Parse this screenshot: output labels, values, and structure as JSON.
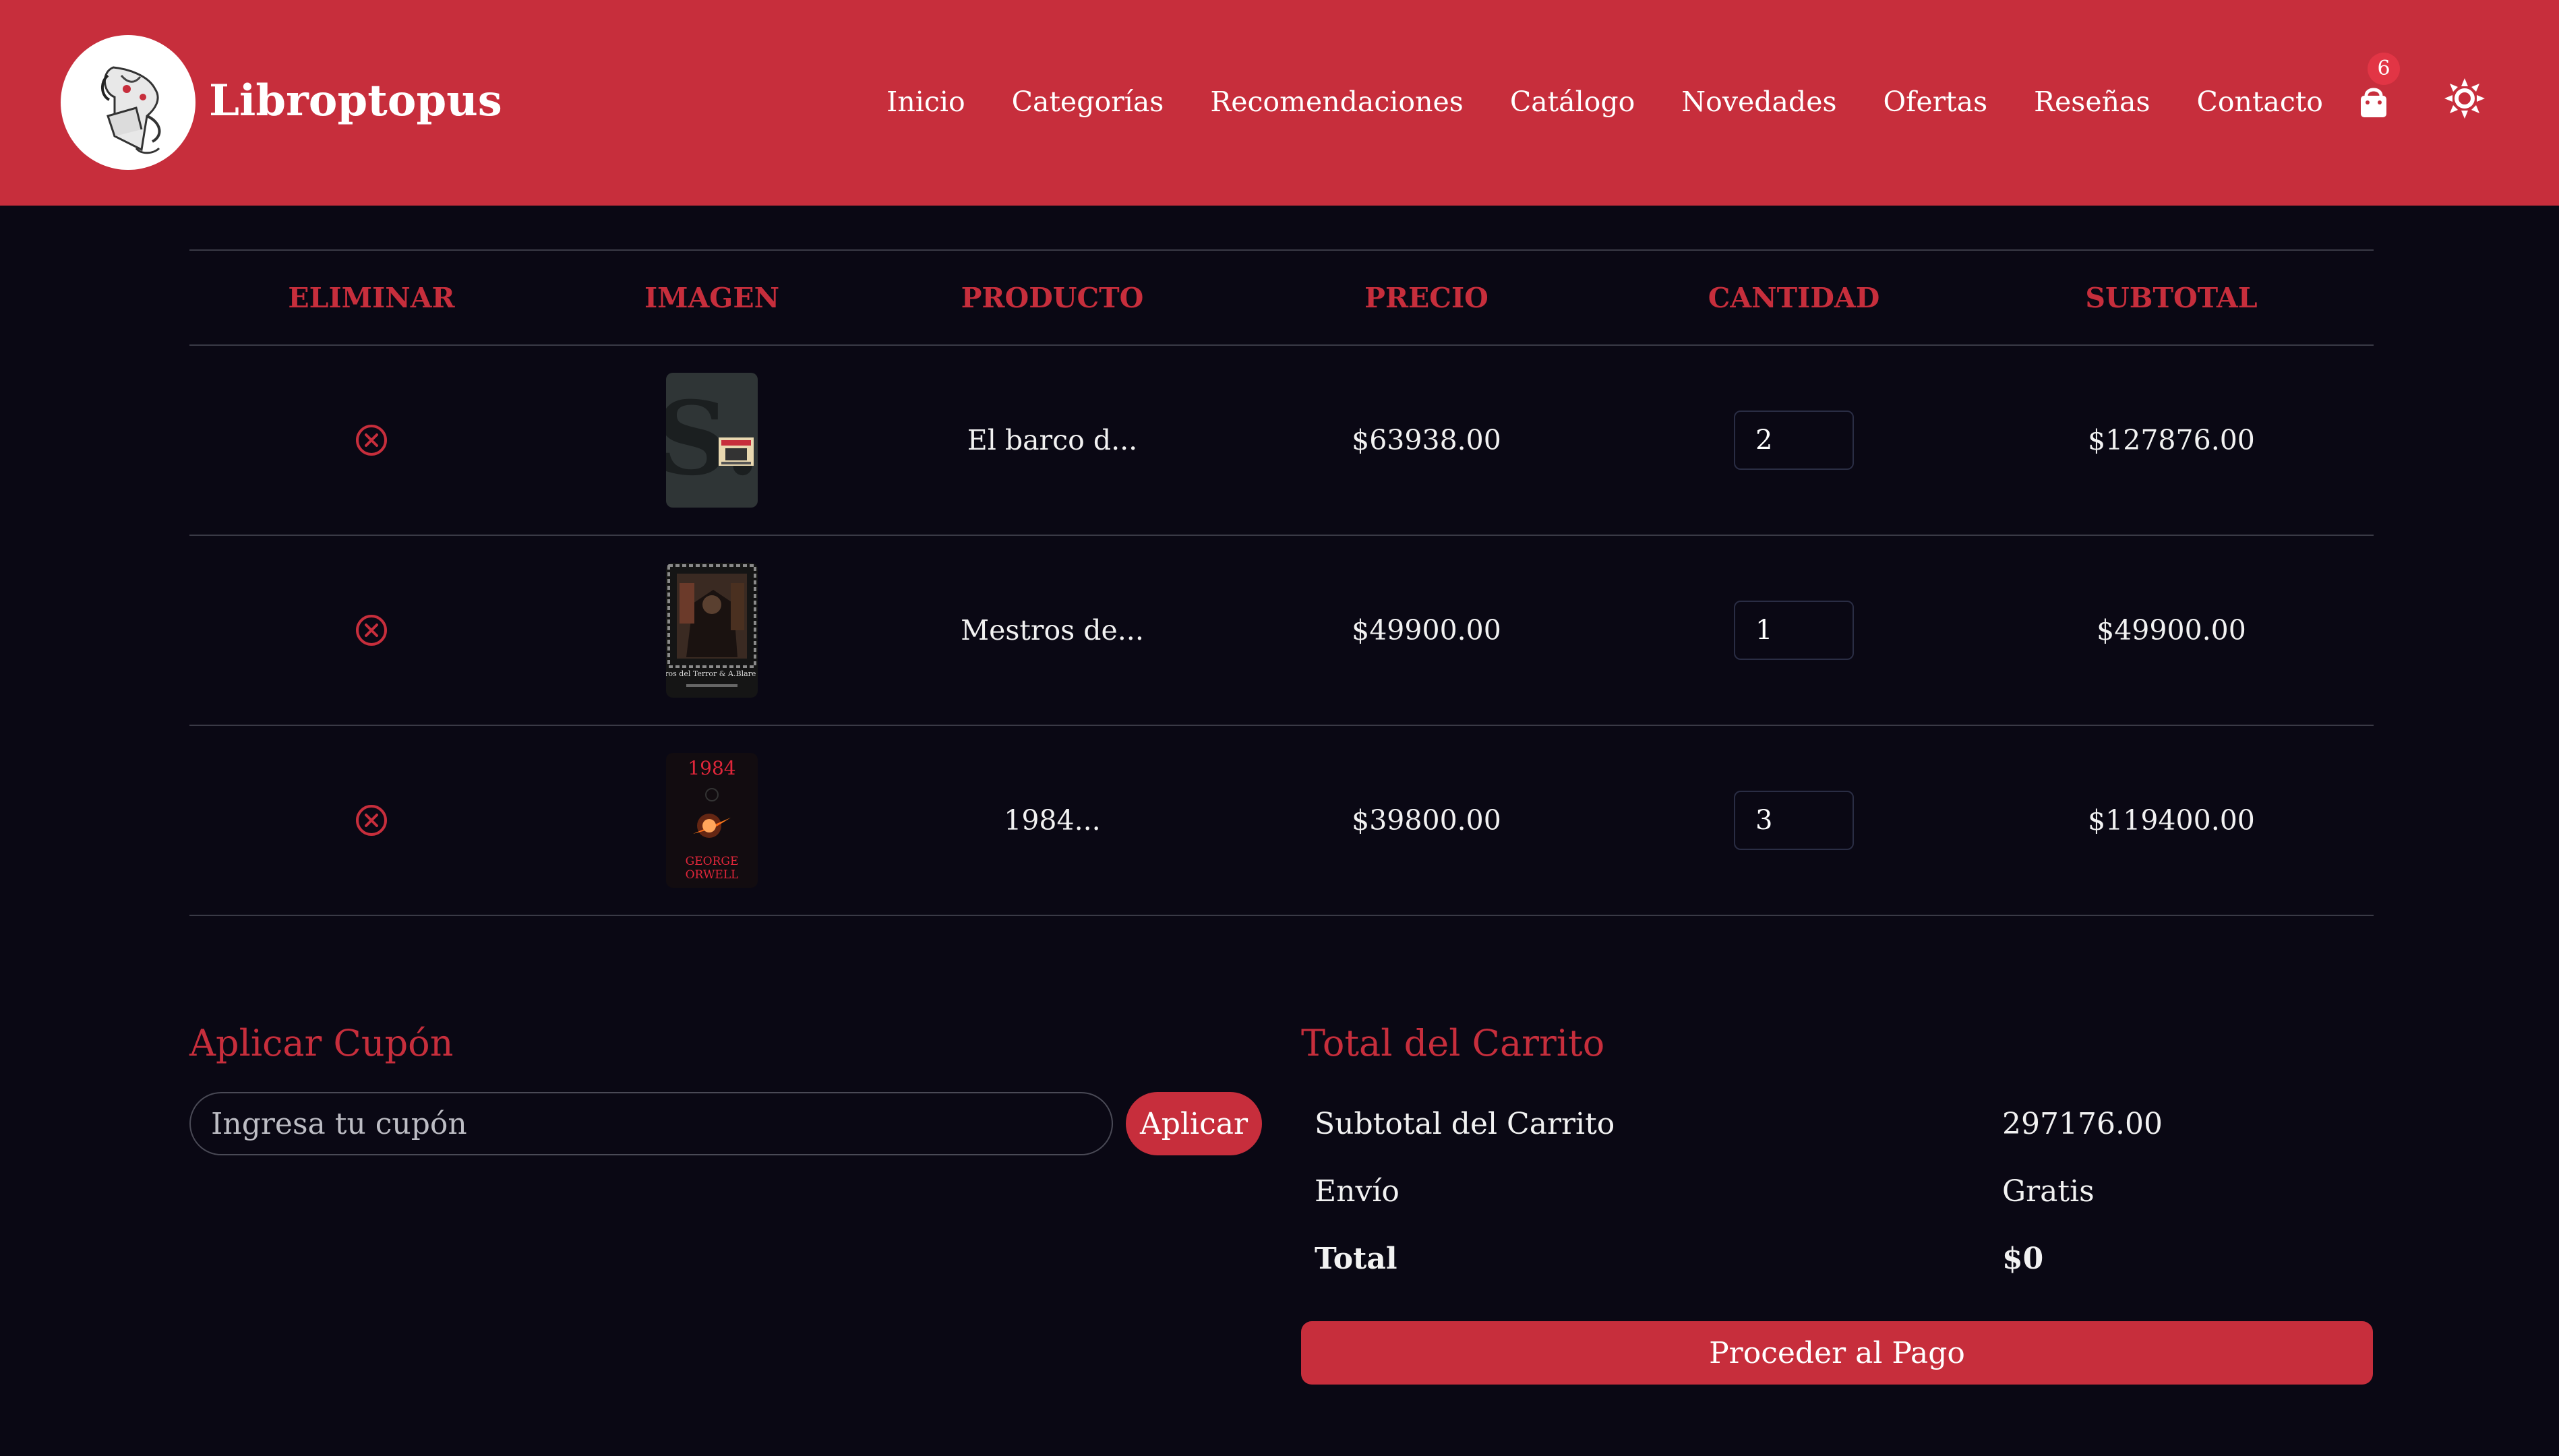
{
  "header": {
    "brand": "Libroptopus",
    "nav": [
      "Inicio",
      "Categorías",
      "Recomendaciones",
      "Catálogo",
      "Novedades",
      "Ofertas",
      "Reseñas",
      "Contacto"
    ],
    "cart_count": "6",
    "cart_icon": "shopping-bag-icon",
    "theme_icon": "sun-icon"
  },
  "table": {
    "headers": [
      "ELIMINAR",
      "IMAGEN",
      "PRODUCTO",
      "PRECIO",
      "CANTIDAD",
      "SUBTOTAL"
    ],
    "rows": [
      {
        "product": "El barco d...",
        "price": "$63938.00",
        "quantity": "2",
        "subtotal": "$127876.00",
        "cover": {
          "letter": "S."
        }
      },
      {
        "product": "Mestros de...",
        "price": "$49900.00",
        "quantity": "1",
        "subtotal": "$49900.00",
        "cover": {
          "caption": "Maestros del Terror & A.Blare Simon"
        }
      },
      {
        "product": "1984...",
        "price": "$39800.00",
        "quantity": "3",
        "subtotal": "$119400.00",
        "cover": {
          "title": "1984",
          "author_line1": "GEORGE",
          "author_line2": "ORWELL"
        }
      }
    ]
  },
  "coupon": {
    "title": "Aplicar Cupón",
    "placeholder": "Ingresa tu cupón",
    "button": "Aplicar"
  },
  "totals": {
    "title": "Total del Carrito",
    "subtotal_label": "Subtotal del Carrito",
    "subtotal_value": "297176.00",
    "shipping_label": "Envío",
    "shipping_value": "Gratis",
    "total_label": "Total",
    "total_value": "$0",
    "checkout_button": "Proceder al Pago"
  },
  "colors": {
    "accent": "#c72e3c",
    "background": "#0a0814"
  }
}
